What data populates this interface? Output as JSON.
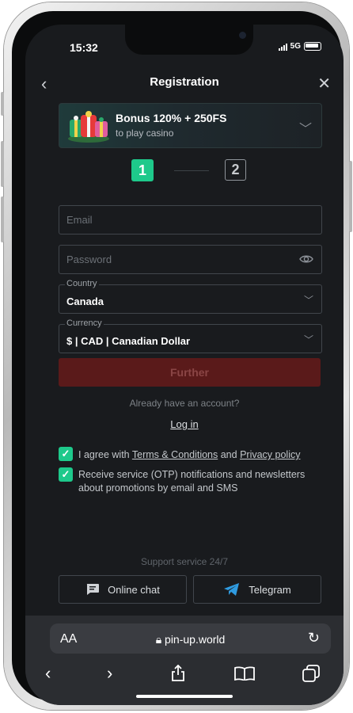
{
  "status": {
    "time": "15:32",
    "network": "5G"
  },
  "header": {
    "title": "Registration"
  },
  "bonus": {
    "title": "Bonus 120% + 250FS",
    "subtitle": "to play casino"
  },
  "steps": {
    "step1": "1",
    "step2": "2"
  },
  "form": {
    "email_placeholder": "Email",
    "password_placeholder": "Password",
    "country_label": "Country",
    "country_value": "Canada",
    "currency_label": "Currency",
    "currency_value": "$ | CAD | Canadian Dollar",
    "further_label": "Further"
  },
  "account": {
    "already": "Already have an account?",
    "login": "Log in"
  },
  "consent": {
    "agree_prefix": "I agree with ",
    "terms": "Terms & Conditions",
    "and": " and ",
    "privacy": "Privacy policy",
    "notifications": "Receive service (OTP) notifications and newsletters about promotions by email and SMS"
  },
  "support": {
    "title": "Support service 24/7",
    "chat": "Online chat",
    "telegram": "Telegram"
  },
  "browser": {
    "aa": "AA",
    "url": "pin-up.world"
  },
  "colors": {
    "accent": "#1ec98b",
    "further_bg": "#5a1a1a",
    "telegram": "#2f9be0"
  }
}
